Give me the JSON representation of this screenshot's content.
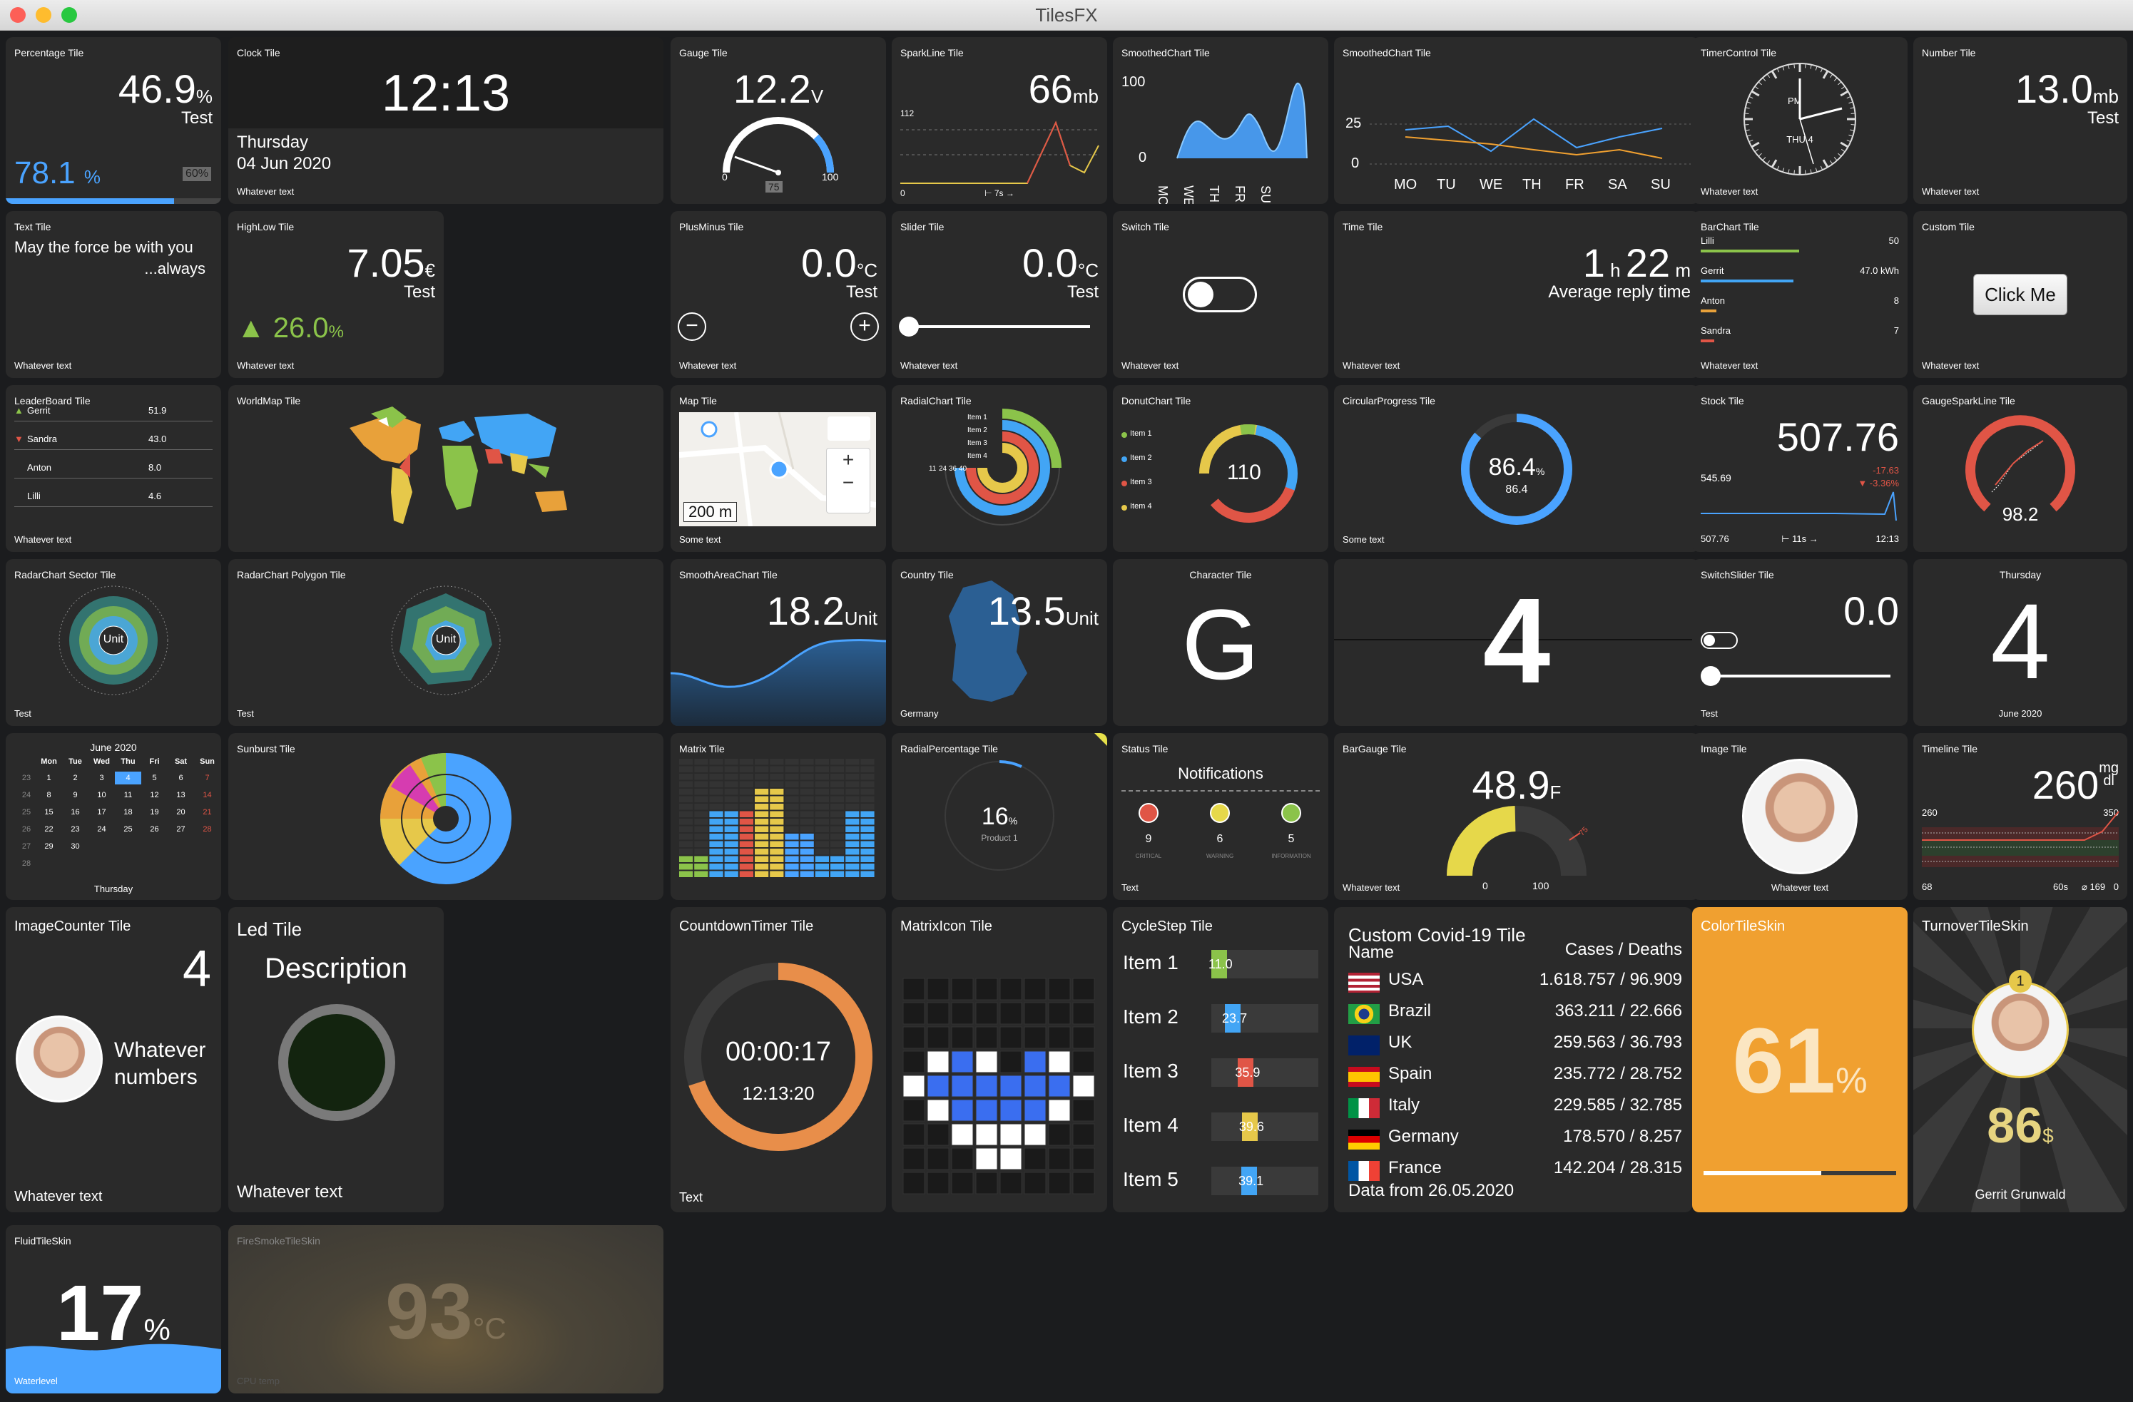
{
  "window": {
    "title": "TilesFX"
  },
  "tiles": {
    "percentage": {
      "title": "Percentage Tile",
      "value": "46.9",
      "unit": "%",
      "desc": "Test",
      "sub_value": "78.1",
      "sub_unit": "%",
      "badge": "60%",
      "progress": 0.78
    },
    "clock": {
      "title": "Clock Tile",
      "time": "12:13",
      "day": "Thursday",
      "date": "04 Jun 2020",
      "text": "Whatever text"
    },
    "gauge": {
      "title": "Gauge Tile",
      "value": "12.2",
      "unit": "V",
      "min": "0",
      "max": "100",
      "marker": "75",
      "level": 0.122
    },
    "sparkline": {
      "title": "SparkLine Tile",
      "value": "66",
      "unit": "mb",
      "top_label": "112",
      "bottom_label": "0",
      "time_label": "⊢ 7s →"
    },
    "smoothed1": {
      "title": "SmoothedChart Tile",
      "ymax": "100",
      "ymin": "0",
      "days": [
        "MO",
        "WE",
        "TH",
        "FR",
        "SU"
      ]
    },
    "smoothed2": {
      "title": "SmoothedChart Tile",
      "ymax": "25",
      "ymin": "0",
      "days": [
        "MO",
        "TU",
        "WE",
        "TH",
        "FR",
        "SA",
        "SU"
      ]
    },
    "timercontrol": {
      "title": "TimerControl Tile",
      "face_label": "THU 4",
      "pm": "PM",
      "text": "Whatever text"
    },
    "number": {
      "title": "Number Tile",
      "value": "13.0",
      "unit": "mb",
      "desc": "Test",
      "text": "Whatever text"
    },
    "text": {
      "title": "Text Tile",
      "line1": "May the force be with you",
      "line2": "...always",
      "text": "Whatever text"
    },
    "highlow": {
      "title": "HighLow Tile",
      "value": "7.05",
      "unit": "€",
      "desc": "Test",
      "delta": "26.0",
      "delta_unit": "%",
      "text": "Whatever text"
    },
    "plusminus": {
      "title": "PlusMinus Tile",
      "value": "0.0",
      "unit": "°C",
      "desc": "Test",
      "text": "Whatever text"
    },
    "slider": {
      "title": "Slider Tile",
      "value": "0.0",
      "unit": "°C",
      "desc": "Test",
      "text": "Whatever text"
    },
    "switch": {
      "title": "Switch Tile",
      "text": "Whatever text"
    },
    "time": {
      "title": "Time Tile",
      "hours": "1",
      "h": "h",
      "minutes": "22",
      "m": "m",
      "desc": "Average reply time",
      "text": "Whatever text"
    },
    "barchart": {
      "title": "BarChart Tile",
      "text": "Whatever text",
      "items": [
        {
          "name": "Lilli",
          "value": "50",
          "color": "#8bc34a",
          "frac": 0.5
        },
        {
          "name": "Gerrit",
          "value": "47.0 kWh",
          "color": "#42a5f5",
          "frac": 0.47
        },
        {
          "name": "Anton",
          "value": "8",
          "color": "#e8a13a",
          "frac": 0.08
        },
        {
          "name": "Sandra",
          "value": "7",
          "color": "#e05546",
          "frac": 0.07
        }
      ]
    },
    "custom": {
      "title": "Custom Tile",
      "button": "Click Me",
      "text": "Whatever text"
    },
    "leaderboard": {
      "title": "LeaderBoard Tile",
      "text": "Whatever text",
      "items": [
        {
          "name": "Gerrit",
          "value": "51.9",
          "trend": "▲",
          "color": "#8bc34a"
        },
        {
          "name": "Sandra",
          "value": "43.0",
          "trend": "▼",
          "color": "#e05546"
        },
        {
          "name": "Anton",
          "value": "8.0",
          "trend": "",
          "color": "#fff"
        },
        {
          "name": "Lilli",
          "value": "4.6",
          "trend": "",
          "color": "#fff"
        }
      ]
    },
    "worldmap": {
      "title": "WorldMap Tile"
    },
    "map": {
      "title": "Map Tile",
      "scale": "200 m",
      "plus": "+",
      "minus": "−",
      "text": "Some text"
    },
    "radialchart": {
      "title": "RadialChart Tile",
      "items": [
        "Item 1",
        "Item 2",
        "Item 3",
        "Item 4"
      ],
      "values": [
        11,
        24,
        36,
        40
      ]
    },
    "donutchart": {
      "title": "DonutChart Tile",
      "value": "110",
      "items": [
        "Item 1",
        "Item 2",
        "Item 3",
        "Item 4"
      ]
    },
    "circularprogress": {
      "title": "CircularProgress Tile",
      "value": "86.4",
      "unit": "%",
      "sub": "86.4",
      "text": "Some text",
      "level": 0.864
    },
    "stock": {
      "title": "Stock Tile",
      "value": "507.76",
      "high": "545.69",
      "low": "507.76",
      "delta": "-17.63",
      "delta_pct": "▼ -3.36%",
      "time": "⊢ 11s →",
      "clock": "12:13"
    },
    "gaugespark": {
      "title": "GaugeSparkLine Tile",
      "value": "98.2",
      "level": 0.982
    },
    "radarsector": {
      "title": "RadarChart Sector Tile",
      "center": "Unit",
      "text": "Test"
    },
    "radarpolygon": {
      "title": "RadarChart Polygon Tile",
      "center": "Unit",
      "text": "Test"
    },
    "smootharea": {
      "title": "SmoothAreaChart Tile",
      "value": "18.2",
      "unit": "Unit"
    },
    "country": {
      "title": "Country Tile",
      "value": "13.5",
      "unit": "Unit",
      "text": "Germany"
    },
    "character": {
      "title": "Character Tile",
      "char": "G"
    },
    "flip": {
      "char": "4"
    },
    "switchslider": {
      "title": "SwitchSlider Tile",
      "value": "0.0",
      "text": "Test"
    },
    "dayofweek": {
      "title": "Thursday",
      "char": "4",
      "text": "June 2020"
    },
    "calendar": {
      "title": "June 2020",
      "footer": "Thursday",
      "headers": [
        "Mon",
        "Tue",
        "Wed",
        "Thu",
        "Fri",
        "Sat",
        "Sun"
      ],
      "weeks": [
        [
          "23",
          "1",
          "2",
          "3",
          "4",
          "5",
          "6",
          "7"
        ],
        [
          "24",
          "8",
          "9",
          "10",
          "11",
          "12",
          "13",
          "14"
        ],
        [
          "25",
          "15",
          "16",
          "17",
          "18",
          "19",
          "20",
          "21"
        ],
        [
          "26",
          "22",
          "23",
          "24",
          "25",
          "26",
          "27",
          "28"
        ],
        [
          "27",
          "29",
          "30",
          "",
          "",
          "",
          "",
          ""
        ],
        [
          "28",
          "",
          "",
          "",
          "",
          "",
          "",
          ""
        ]
      ]
    },
    "sunburst": {
      "title": "Sunburst Tile"
    },
    "matrix": {
      "title": "Matrix Tile"
    },
    "radialpercentage": {
      "title": "RadialPercentage Tile",
      "value": "16",
      "unit": "%",
      "sub": "Product 1"
    },
    "status": {
      "title": "Status Tile",
      "heading": "Notifications",
      "text": "Text",
      "items": [
        {
          "count": "9",
          "label": "CRITICAL",
          "color": "#e05546"
        },
        {
          "count": "6",
          "label": "WARNING",
          "color": "#e6d84a"
        },
        {
          "count": "5",
          "label": "INFORMATION",
          "color": "#8bc34a"
        }
      ]
    },
    "bargauge": {
      "title": "BarGauge Tile",
      "value": "48.9",
      "unit": "F",
      "min": "0",
      "max": "100",
      "threshold": "75",
      "level": 0.489,
      "text": "Whatever text"
    },
    "image": {
      "title": "Image Tile",
      "text": "Whatever text"
    },
    "timeline": {
      "title": "Timeline Tile",
      "value": "260",
      "unit_top": "mg",
      "unit_bottom": "dl",
      "ytop": "260",
      "ytop_r": "350",
      "ybottom": "68",
      "time": "60s",
      "avg": "⌀ 169",
      "zero": "0"
    },
    "imagecounter": {
      "title": "ImageCounter Tile",
      "value": "4",
      "desc_line1": "Whatever",
      "desc_line2": "numbers",
      "text": "Whatever text"
    },
    "led": {
      "title": "Led Tile",
      "desc": "Description",
      "text": "Whatever text"
    },
    "countdown": {
      "title": "CountdownTimer Tile",
      "time": "00:00:17",
      "clock": "12:13:20",
      "text": "Text",
      "level": 0.7
    },
    "matrixicon": {
      "title": "MatrixIcon Tile"
    },
    "cyclestep": {
      "title": "CycleStep Tile",
      "items": [
        {
          "name": "Item 1",
          "value": "11.0",
          "color": "#8bc34a",
          "frac": 0.11
        },
        {
          "name": "Item 2",
          "value": "23.7",
          "color": "#42a5f5",
          "frac": 0.237
        },
        {
          "name": "Item 3",
          "value": "35.9",
          "color": "#e05546",
          "frac": 0.359
        },
        {
          "name": "Item 4",
          "value": "39.6",
          "color": "#e6c84a",
          "frac": 0.396
        },
        {
          "name": "Item 5",
          "value": "39.1",
          "color": "#42a5f5",
          "frac": 0.391
        }
      ]
    },
    "covid": {
      "title": "Custom Covid-19 Tile",
      "col_name": "Name",
      "col_cases": "Cases / Deaths",
      "footer": "Data from 26.05.2020",
      "rows": [
        {
          "country": "USA",
          "value": "1.618.757 / 96.909"
        },
        {
          "country": "Brazil",
          "value": "363.211 / 22.666"
        },
        {
          "country": "UK",
          "value": "259.563 / 36.793"
        },
        {
          "country": "Spain",
          "value": "235.772 / 28.752"
        },
        {
          "country": "Italy",
          "value": "229.585 / 32.785"
        },
        {
          "country": "Germany",
          "value": "178.570 / 8.257"
        },
        {
          "country": "France",
          "value": "142.204 / 28.315"
        }
      ]
    },
    "color": {
      "title": "ColorTileSkin",
      "value": "61",
      "unit": "%",
      "level": 0.61,
      "bg": "#f0a030"
    },
    "turnover": {
      "title": "TurnoverTileSkin",
      "rank": "1",
      "value": "86",
      "unit": "$",
      "name": "Gerrit Grunwald"
    },
    "fluid": {
      "title": "FluidTileSkin",
      "value": "17",
      "unit": "%",
      "text": "Waterlevel",
      "level": 0.17
    },
    "firesmoke": {
      "title": "FireSmokeTileSkin",
      "value": "93",
      "unit": "°C",
      "text": "CPU temp"
    }
  }
}
